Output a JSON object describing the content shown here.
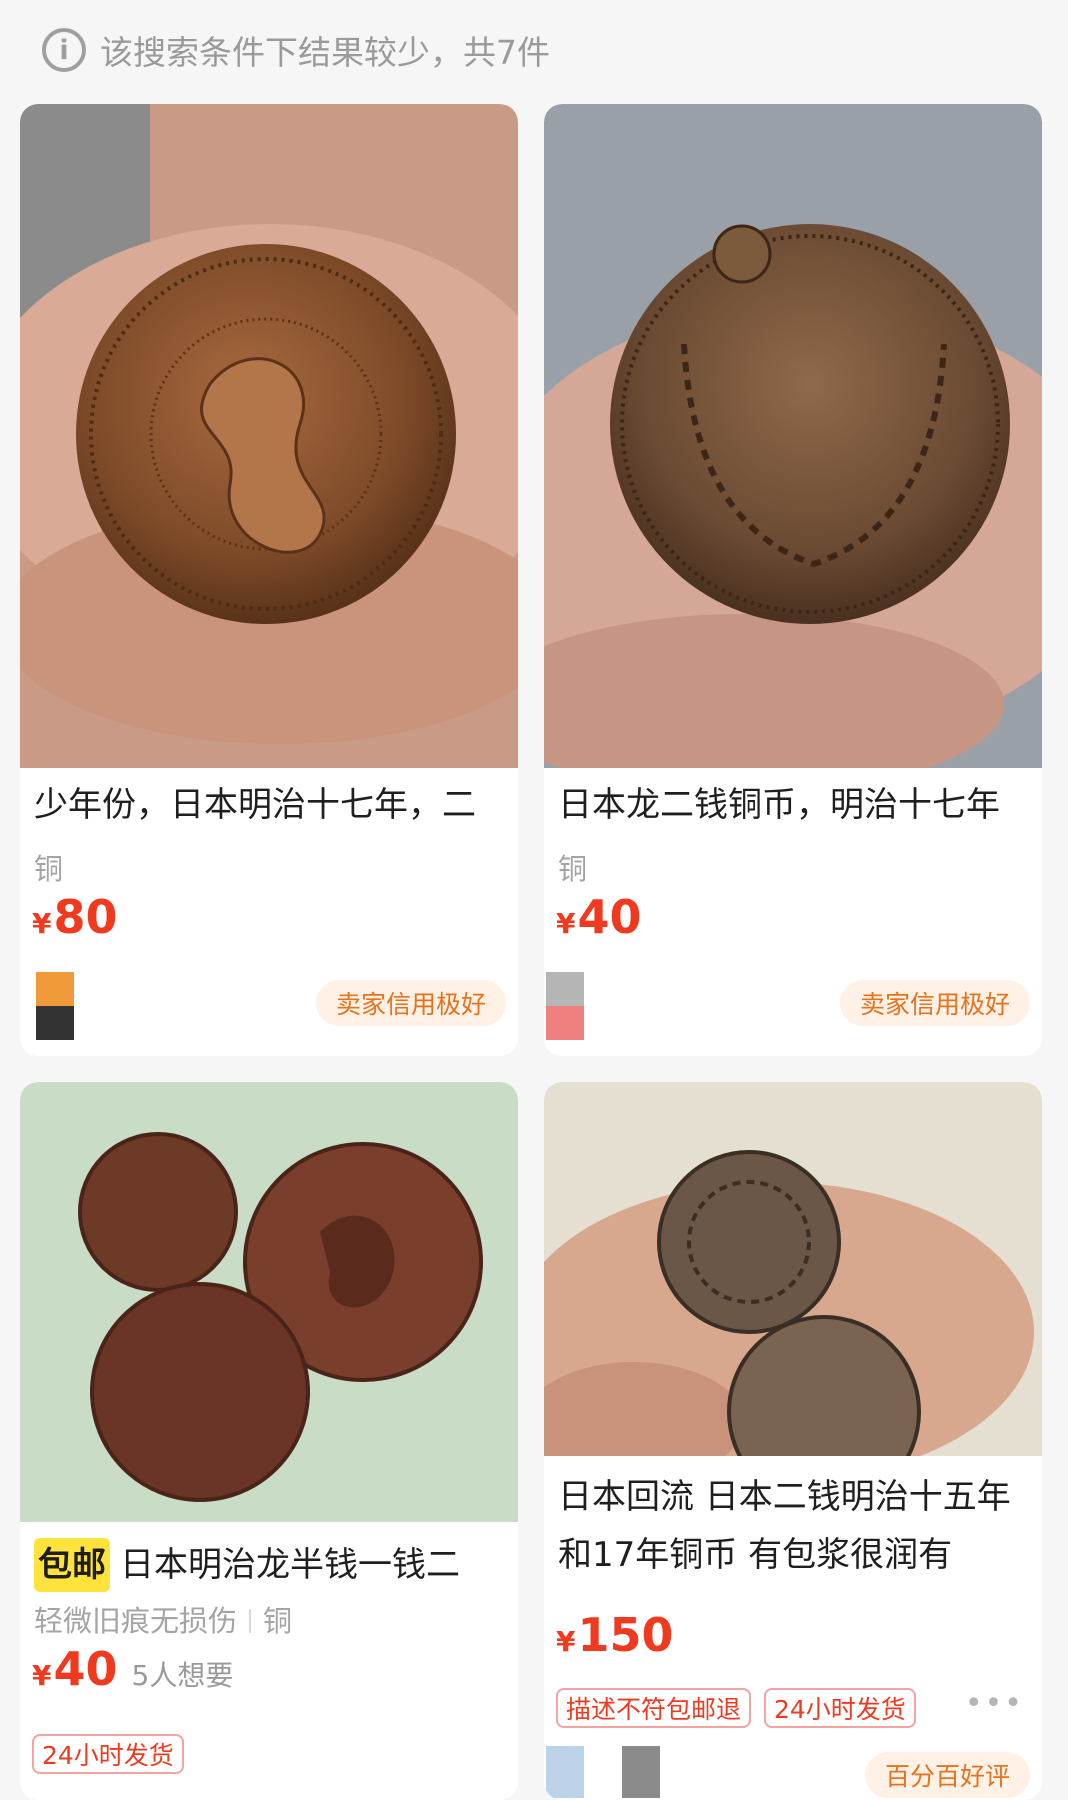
{
  "notice": {
    "icon": "info-icon",
    "text": "该搜索条件下结果较少，共7件"
  },
  "items": [
    {
      "title": "少年份，日本明治十七年，二",
      "material": "铜",
      "currency": "¥",
      "price": "80",
      "credit": "卖家信用极好"
    },
    {
      "title": "日本龙二钱铜币，明治十七年",
      "material": "铜",
      "currency": "¥",
      "price": "40",
      "credit": "卖家信用极好"
    },
    {
      "badge": "包邮",
      "title": "日本明治龙半钱一钱二",
      "condition": "轻微旧痕无损伤",
      "material": "铜",
      "currency": "¥",
      "price": "40",
      "wants": "5人想要",
      "tag": "24小时发货"
    },
    {
      "title": "日本回流 日本二钱明治十五年和17年铜币 有包浆很润有",
      "currency": "¥",
      "price": "150",
      "tags": [
        "描述不符包邮退",
        "24小时发货"
      ],
      "credit": "百分百好评"
    }
  ],
  "colors": {
    "price": "#ef3a1f",
    "credit_text": "#e8721c",
    "credit_bg": "#fff1e6",
    "baoyou_bg": "#ffe23b"
  }
}
